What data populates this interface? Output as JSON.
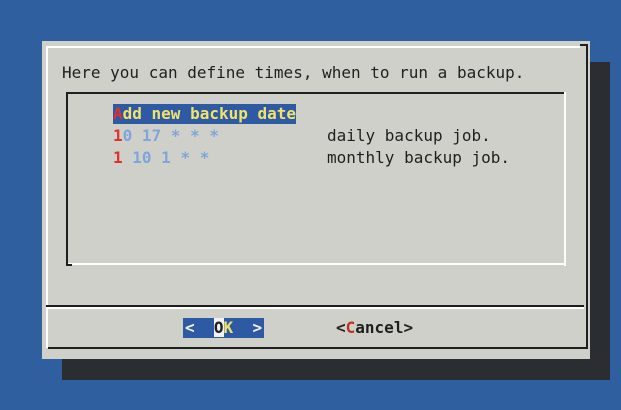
{
  "prompt": "Here you can define times, when to run a backup.",
  "list": {
    "items": [
      {
        "hotkey": "A",
        "rest": "dd new backup date",
        "description": ""
      },
      {
        "hotkey": "1",
        "rest": "0 17 * * *",
        "description": "daily backup job."
      },
      {
        "hotkey": "1",
        "rest": " 10 1 * *",
        "description": "monthly backup job."
      }
    ]
  },
  "buttons": {
    "ok": {
      "left": "<  ",
      "cursor": "O",
      "hot": "K",
      "right": "  >"
    },
    "cancel": {
      "left": "<",
      "hot": "C",
      "rest": "ancel>"
    }
  },
  "colors": {
    "background": "#2f5f9e",
    "dialog": "#d0d0ca",
    "selection": "#2e5aa4",
    "selection_text": "#f2e26a",
    "hotkey": "#e0302a",
    "tag": "#7fa6d8"
  }
}
